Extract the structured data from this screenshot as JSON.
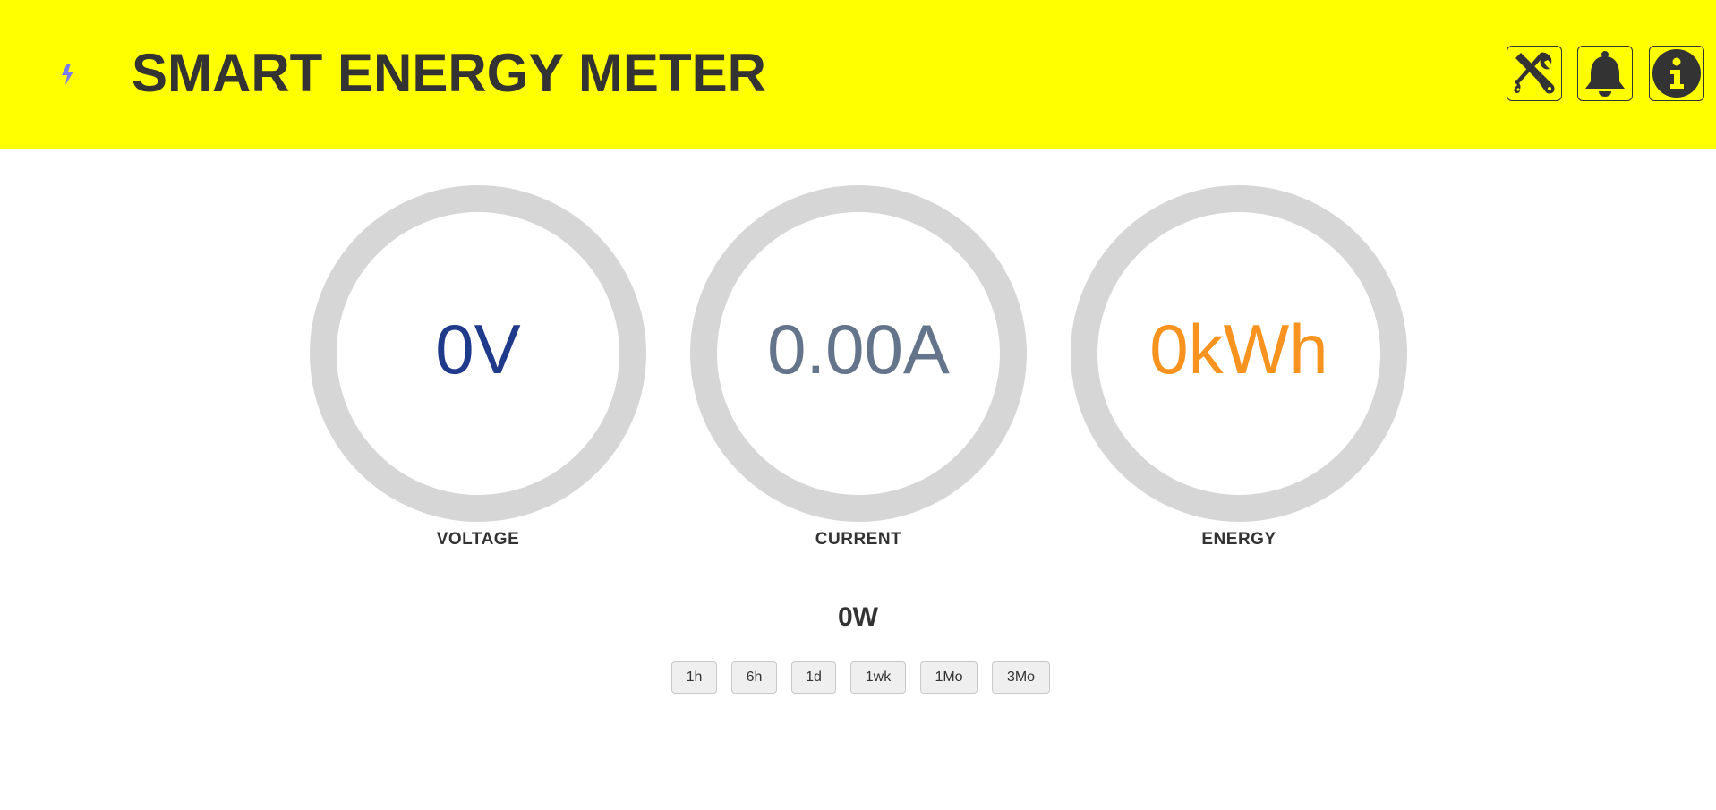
{
  "header": {
    "title": "SMART ENERGY METER",
    "logo_icon": "lightning-bolt-icon",
    "background": "#ffff00",
    "buttons": [
      {
        "icon": "settings-tools-icon"
      },
      {
        "icon": "bell-icon"
      },
      {
        "icon": "info-icon"
      }
    ]
  },
  "gauges": {
    "voltage": {
      "value": "0V",
      "label": "VOLTAGE",
      "color": "#1f3a8a"
    },
    "current": {
      "value": "0.00A",
      "label": "CURRENT",
      "color": "#64748b"
    },
    "energy": {
      "value": "0kWh",
      "label": "ENERGY",
      "color": "#f7931e"
    }
  },
  "power": {
    "value": "0W"
  },
  "time_ranges": [
    "1h",
    "6h",
    "1d",
    "1wk",
    "1Mo",
    "3Mo"
  ]
}
